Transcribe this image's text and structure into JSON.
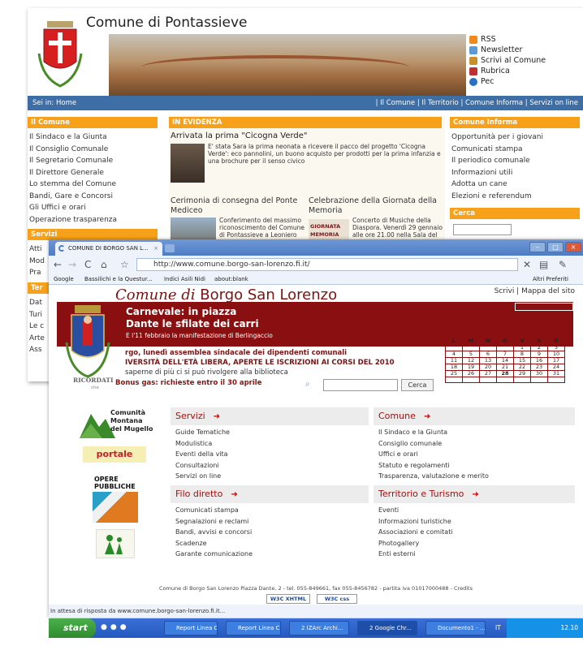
{
  "pontassieve": {
    "title": "Comune di Pontassieve",
    "header_links": [
      "RSS",
      "Newsletter",
      "Scrivi al Comune",
      "Rubrica",
      "Pec"
    ],
    "breadcrumb": "Sei in: Home",
    "topnav": "|  Il Comune  |  Il Territorio  |  Comune Informa  |  Servizi on line",
    "il_comune": {
      "title": "Il Comune",
      "items": [
        "Il Sindaco e la Giunta",
        "Il Consiglio Comunale",
        "Il Segretario Comunale",
        "Il Direttore Generale",
        "Lo stemma del Comune",
        "Bandi, Gare e Concorsi",
        "Gli Uffici e orari",
        "Operazione trasparenza"
      ]
    },
    "servizi": {
      "title": "Servizi",
      "items": [
        "Atti",
        "Mod",
        "Pra"
      ]
    },
    "ter": {
      "title": "Ter",
      "items": [
        "Dat",
        "Turi",
        "Le c",
        "Arte",
        "Ass"
      ]
    },
    "evidenza": {
      "title": "IN EVIDENZA",
      "news1_title": "Arrivata la prima \"Cicogna Verde\"",
      "news1_text": "E' stata Sara la prima neonata a ricevere il pacco del progetto 'Cicogna Verde': eco pannolini, un buono acquisto per prodotti per la prima infanzia e una brochure per il  senso civico",
      "news2_title": "Cerimonia di consegna del Ponte Mediceo",
      "news2_text": "Conferimento del massimo riconoscimento del Comune di Pontassieve a Leoniero",
      "news3_title": "Celebrazione della Giornata della Memoria",
      "news3_text": "Concerto di Musiche della Diaspora. Venerdì 29 gennaio alle ore 21.00 nella Sala del",
      "news3_img": "GIORNATA MEMORIA"
    },
    "comune_informa": {
      "title": "Comune Informa",
      "items": [
        "Opportunità per i giovani",
        "Comunicati stampa",
        "Il periodico comunale",
        "Informazioni utili",
        "Adotta un cane",
        "Elezioni e referendum"
      ]
    },
    "cerca": {
      "title": "Cerca"
    }
  },
  "browser": {
    "tab_title": "COMUNE DI BORGO SAN L...",
    "url": "http://www.comune.borgo-san-lorenzo.fi.it/",
    "bookmarks": [
      "Google",
      "Bassilichi e la Questur...",
      "Indici Asili Nidi",
      "about:blank"
    ],
    "other_bookmarks": "Altri Preferiti",
    "status": "In attesa di risposta da www.comune.borgo-san-lorenzo.fi.it..."
  },
  "borgo": {
    "title_prefix": "Comune di",
    "title_name": "Borgo San Lorenzo",
    "top_links": "Scrivi  |  Mappa del sito",
    "banner_line1": "Carnevale: in piazza",
    "banner_line2": "Dante le sfilate dei carri",
    "banner_line3": "E l'11 febbraio la manifestazione di Berlingaccio",
    "news1": "rgo, lunedì assemblea sindacale dei dipendenti comunali",
    "news2": "IVERSITÀ DELL'ETÀ LIBERA, APERTE LE ISCRIZIONI AI CORSI DEL 2010",
    "news3": "saperne di più ci si può rivolgere alla biblioteca",
    "ricordati": "RICORDATI",
    "ricordati_sub": "che",
    "bonus": "Bonus gas: richieste entro il 30 aprile",
    "search_button": "Cerca",
    "calendar": {
      "head": [
        "L",
        "M",
        "M",
        "G",
        "V",
        "S",
        "D"
      ],
      "rows": [
        [
          "",
          "",
          "",
          "",
          "1",
          "2",
          "3"
        ],
        [
          "4",
          "5",
          "6",
          "7",
          "8",
          "9",
          "10"
        ],
        [
          "11",
          "12",
          "13",
          "14",
          "15",
          "16",
          "17"
        ],
        [
          "18",
          "19",
          "20",
          "21",
          "22",
          "23",
          "24"
        ],
        [
          "25",
          "26",
          "27",
          "28",
          "29",
          "30",
          "31"
        ]
      ]
    },
    "logos": {
      "comunita": [
        "Comunità",
        "Montana",
        "del Mugello"
      ],
      "portale": "portale",
      "opere": [
        "OPERE",
        "PUBBLICHE"
      ]
    },
    "servizi": {
      "title": "Servizi",
      "items": [
        "Guide Tematiche",
        "Modulistica",
        "Eventi della vita",
        "Consultazioni",
        "Servizi on line"
      ]
    },
    "comune": {
      "title": "Comune",
      "items": [
        "Il Sindaco e la Giunta",
        "Consiglio comunale",
        "Uffici e orari",
        "Statuto e regolamenti",
        "Trasparenza, valutazione e merito"
      ]
    },
    "filo": {
      "title": "Filo diretto",
      "items": [
        "Comunicati stampa",
        "Segnalazioni e reclami",
        "Bandi, avvisi e concorsi",
        "Scadenze",
        "Garante comunicazione"
      ]
    },
    "territorio": {
      "title": "Territorio e Turismo",
      "items": [
        "Eventi",
        "Informazioni turistiche",
        "Associazioni e comitati",
        "Photogallery",
        "Enti esterni"
      ]
    },
    "footer": "Comune di Borgo San Lorenzo Piazza Dante, 2 - tel. 055-849661, fax 055-8456782 - partita iva 01017000488 - Credits",
    "badges": [
      "W3C XHTML 1.0",
      "W3C css"
    ]
  },
  "taskbar": {
    "start": "start",
    "buttons": [
      "Report Linea C...",
      "Report Linea C...",
      "2 IZArc Archi...",
      "2 Google Chr...",
      "Documento1 - ..."
    ],
    "lang": "IT",
    "clock": "12.10"
  }
}
